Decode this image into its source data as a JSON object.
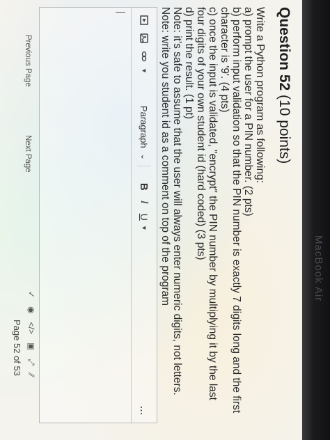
{
  "question": {
    "title": "Question 52",
    "points": "(10 points)",
    "lines": [
      "Write a Python program as following:",
      "a) prompt the user for a PIN number. (2 pts)",
      "b) perform input validation so that the PIN number is exactly 7 digits long and the first",
      "character is '9'. (4 pts)",
      "c) once the input is validated, \"encrypt\" the PIN number by multiplying it by the last",
      "four digits of your own student id (hard coded) (3 pts)",
      "d) print the result. (1 pt)",
      "Note: it's safe to assume that the user will always enter numeric digits, not letters.",
      "Note: write you student id as a comment on top of the program"
    ]
  },
  "toolbar": {
    "paragraph_label": "Paragraph",
    "bold_label": "B",
    "italic_label": "I",
    "underline_label": "U",
    "more_label": "..."
  },
  "icons": {
    "media": "media-icon",
    "image": "image-icon",
    "link": "link-icon",
    "spellcheck": "spellcheck-icon",
    "accessibility": "accessibility-icon",
    "embed": "embed-icon",
    "preview": "preview-icon",
    "fullscreen": "fullscreen-icon",
    "format_painter": "format-painter-icon"
  },
  "footer": {
    "previous_label": "Previous Page",
    "next_label": "Next Page",
    "page_indicator": "Page 52 of 53"
  },
  "device": {
    "bezel_label": "MacBook Air"
  }
}
